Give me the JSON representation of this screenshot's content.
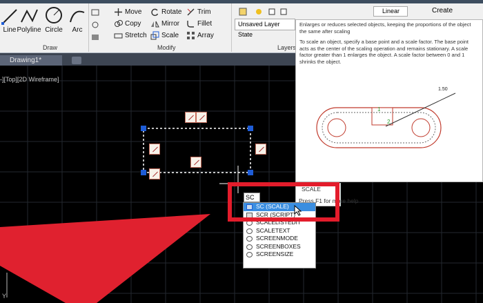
{
  "ribbon": {
    "draw_tools": [
      {
        "label": "Line",
        "icon": "line-icon"
      },
      {
        "label": "Polyline",
        "icon": "polyline-icon"
      },
      {
        "label": "Circle",
        "icon": "circle-icon"
      },
      {
        "label": "Arc",
        "icon": "arc-icon"
      }
    ],
    "modify_tools": [
      {
        "label": "Move",
        "icon": "move-icon"
      },
      {
        "label": "Rotate",
        "icon": "rotate-icon"
      },
      {
        "label": "Trim",
        "icon": "trim-icon"
      },
      {
        "label": "Copy",
        "icon": "copy-icon"
      },
      {
        "label": "Mirror",
        "icon": "mirror-icon"
      },
      {
        "label": "Fillet",
        "icon": "fillet-icon"
      },
      {
        "label": "Stretch",
        "icon": "stretch-icon"
      },
      {
        "label": "Scale",
        "icon": "scale-icon"
      },
      {
        "label": "Array",
        "icon": "array-icon"
      }
    ],
    "draw_panel_label": "Draw",
    "modify_panel_label": "Modify",
    "layers_panel_label": "Layers",
    "layer_state": "Unsaved Layer State",
    "linear_label": "Linear",
    "create_label": "Create"
  },
  "tabs": {
    "file_tab": "Drawing1*"
  },
  "viewport_label": "-][Top][2D Wireframe]",
  "tooltip": {
    "summary": "Enlarges or reduces selected objects, keeping the proportions of the object the same after scaling",
    "detail": "To scale an object, specify a base point and a scale factor. The base point acts as the center of the scaling operation and remains stationary. A scale factor greater than 1 enlarges the object. A scale factor between 0 and 1 shrinks the object.",
    "illus_value": "1.50",
    "illus_label_1": "1",
    "illus_label_2": "2"
  },
  "side_tip": {
    "command": "SCALE",
    "help": "Press F1 for more help"
  },
  "command": {
    "input_value": "SC",
    "suggestions": [
      "SC (SCALE)",
      "SCR (SCRIPT)",
      "SCALELISTEDIT",
      "SCALETEXT",
      "SCREENMODE",
      "SCREENBOXES",
      "SCREENSIZE"
    ],
    "selected_index": 0
  },
  "ucs_label": "Y",
  "colors": {
    "highlight_red": "#e31c2b",
    "grip_blue": "#1e5cd6",
    "select_blue": "#3b8ee0",
    "canvas": "#000000"
  }
}
